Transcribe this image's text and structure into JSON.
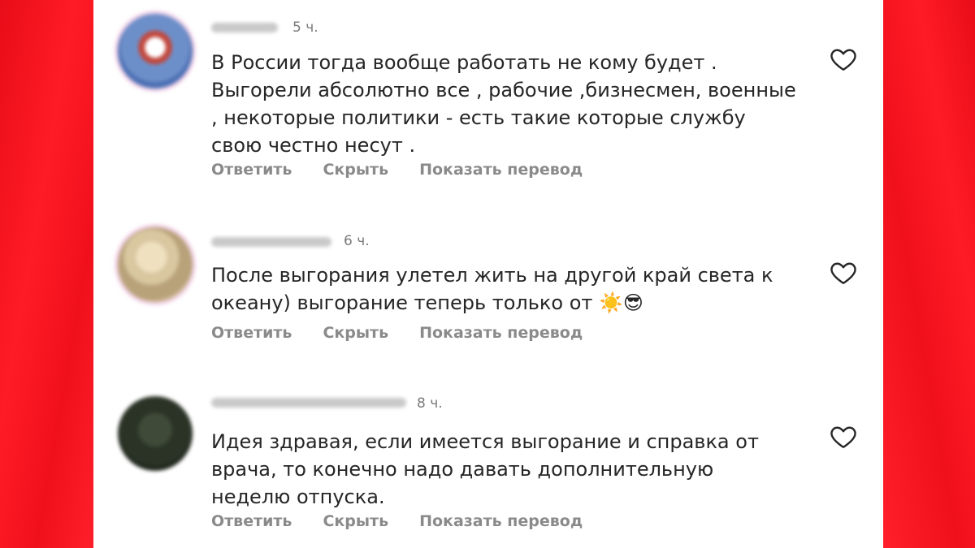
{
  "comments": [
    {
      "time": "5 ч.",
      "text": "В России тогда вообще работать не кому будет . Выгорели абсолютно все , рабочие ,бизнесмен, военные , некоторые политики - есть такие которые службу свою честно несут .",
      "actions": [
        "Ответить",
        "Скрыть",
        "Показать перевод"
      ]
    },
    {
      "time": "6 ч.",
      "text": "После выгорания улетел жить на другой край света к океану) выгорание теперь только от",
      "emoji": "☀️😎",
      "actions": [
        "Ответить",
        "Скрыть",
        "Показать перевод"
      ]
    },
    {
      "time": "8 ч.",
      "text": "Идея здравая, если имеется выгорание и справка от врача, то конечно надо давать дополнительную неделю отпуска.",
      "actions": [
        "Ответить",
        "Скрыть",
        "Показать перевод"
      ]
    }
  ],
  "icons": {
    "like": "heart-outline-icon",
    "avatar": "blurred-user-avatar"
  },
  "colors": {
    "background": "#f4121e",
    "panel": "#ffffff",
    "text": "#262626",
    "secondary": "#8a8a8a"
  }
}
